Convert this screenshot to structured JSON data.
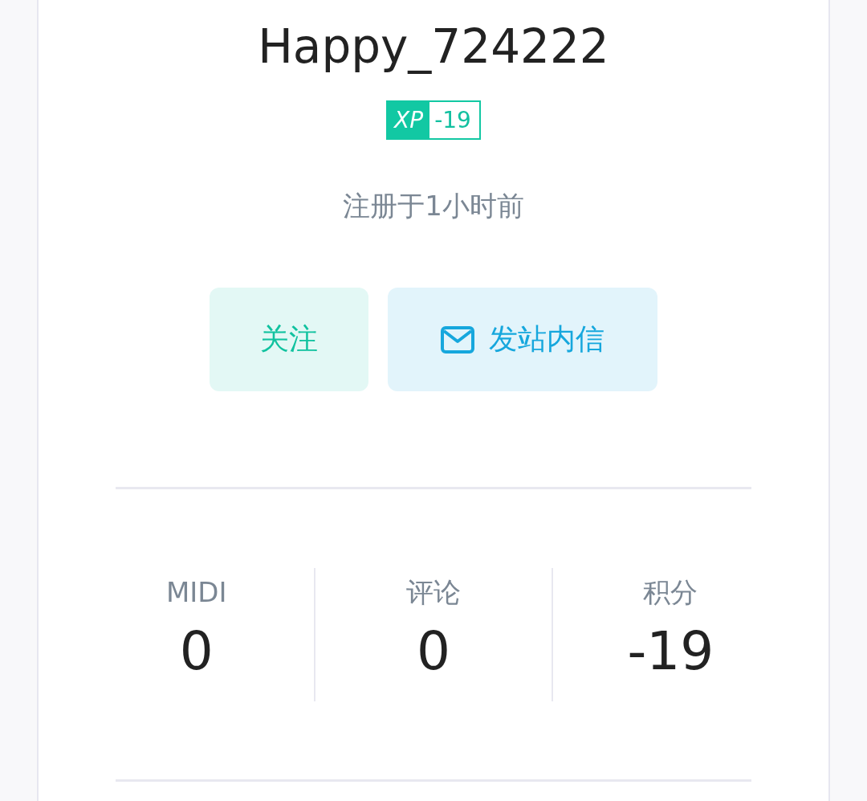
{
  "profile": {
    "username": "Happy_724222",
    "xp_badge": {
      "label": "XP",
      "value": "-19"
    },
    "registered": "注册于1小时前"
  },
  "actions": [
    {
      "kind": "follow",
      "label": "关注"
    },
    {
      "kind": "message",
      "label": "发站内信"
    }
  ],
  "stats": [
    {
      "label": "MIDI",
      "value": "0"
    },
    {
      "label": "评论",
      "value": "0"
    },
    {
      "label": "积分",
      "value": "-19"
    }
  ]
}
